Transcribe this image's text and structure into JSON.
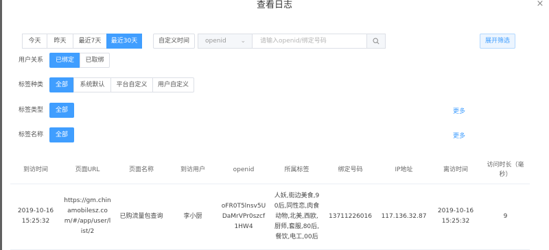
{
  "dialog": {
    "title": "查看日志"
  },
  "date_range": {
    "buttons": [
      {
        "label": "今天",
        "active": false
      },
      {
        "label": "昨天",
        "active": false
      },
      {
        "label": "最近7天",
        "active": false
      },
      {
        "label": "最近30天",
        "active": true
      }
    ],
    "custom_label": "自定义时间"
  },
  "search": {
    "field_select": "openid",
    "placeholder": "请输入openid/绑定号码"
  },
  "expand_filter_label": "展开筛选",
  "filters": {
    "relation": {
      "label": "用户关系",
      "options": [
        "已绑定",
        "已取绑"
      ],
      "active": 0
    },
    "tag_kind": {
      "label": "标签种类",
      "options": [
        "全部",
        "系统默认",
        "平台自定义",
        "用户自定义"
      ],
      "active": 0
    },
    "tag_type": {
      "label": "标签类型",
      "options": [
        "全部"
      ],
      "active": 0,
      "more": "更多"
    },
    "tag_name": {
      "label": "标签名称",
      "options": [
        "全部"
      ],
      "active": 0,
      "more": "更多"
    }
  },
  "table": {
    "columns": [
      "到访时间",
      "页面URL",
      "页面名称",
      "到访用户",
      "openid",
      "所属标签",
      "绑定号码",
      "IP地址",
      "离访时间",
      "访问时长（毫秒）"
    ],
    "rows": [
      [
        "2019-10-16 15:25:32",
        "https://gm.chinamobilesz.com/#/app/user/list/2",
        "已购流量包查询",
        "李小厨",
        "oFR0T5lnsv5UDaMrVPr0szcf1HW4",
        "人妖,街边美食,90后,同性恋,肉食动物,北美,西欧,厨师,套服,80后,餐饮,电工,00后",
        "13711226016",
        "117.136.32.87",
        "2019-10-16 15:25:32",
        "9"
      ]
    ]
  },
  "colors": {
    "accent": "#409eff",
    "border": "#dcdfe6",
    "text": "#333333"
  },
  "icons": {
    "close": "close-icon",
    "search": "search-icon",
    "dropdown": "chevron-down-icon"
  }
}
